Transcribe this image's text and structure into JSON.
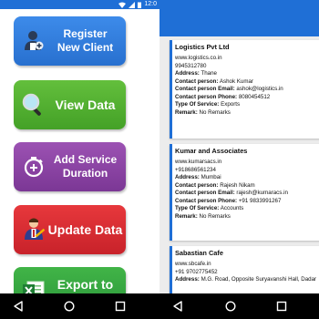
{
  "status": {
    "time": "12:0",
    "accent": "#1f6fd6"
  },
  "menu": {
    "register": {
      "line1": "Register",
      "line2": "New Client",
      "icon": "user-add-icon",
      "color": "#2f7cdc"
    },
    "view": {
      "label": "View Data",
      "icon": "search-icon",
      "color": "#52b032"
    },
    "service": {
      "line1": "Add Service",
      "line2": "Duration",
      "icon": "timer-icon",
      "color": "#8a43a3"
    },
    "update": {
      "label": "Update Data",
      "icon": "edit-person-icon",
      "color": "#d82c31"
    },
    "export": {
      "label": "Export to",
      "icon": "excel-icon",
      "color": "#36a840"
    }
  },
  "clients": [
    {
      "name": "Logistics Pvt Ltd",
      "website": "www.logistics.co.in",
      "phone": "9945312780",
      "address_label": "Address:",
      "address": "Thane",
      "cp_label": "Contact person:",
      "cp": "Ashok Kumar",
      "email_label": "Contact person Email:",
      "email": "ashok@logistics.in",
      "cphone_label": "Contact person Phone:",
      "cphone": "8080454512",
      "service_label": "Type Of Service:",
      "service": "Exports",
      "remark_label": "Remark:",
      "remark": "No Remarks"
    },
    {
      "name": "Kumar and Associates",
      "website": "www.kumarsacs.in",
      "phone": "+918686561234",
      "address_label": "Address:",
      "address": "Mumbai",
      "cp_label": "Contact person:",
      "cp": "Rajesh Nikam",
      "email_label": "Contact person Email:",
      "email": "rajesh@kumaracs.in",
      "cphone_label": "Contact person Phone:",
      "cphone": "+91 9833991267",
      "service_label": "Type Of Service:",
      "service": "Accounts",
      "remark_label": "Remark:",
      "remark": "No Remarks"
    },
    {
      "name": "Sabastian Cafe",
      "website": "www.sbcafe.in",
      "phone": "+91 9702775452",
      "address_label": "Address:",
      "address": "M.G. Road, Opposite Suryavanshi Hall, Dadar"
    }
  ],
  "nav": {
    "back": "back-icon",
    "home": "home-icon",
    "recents": "recents-icon"
  }
}
